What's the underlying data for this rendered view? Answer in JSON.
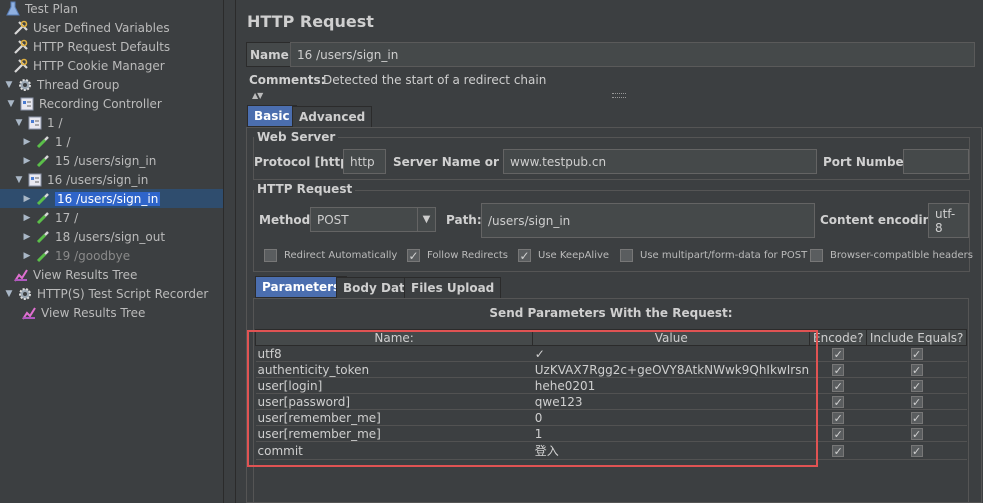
{
  "tree": {
    "items": [
      {
        "label": "Test Plan",
        "icon": "flask-icon",
        "toggle": ""
      },
      {
        "label": "User Defined Variables",
        "icon": "wrench-icon",
        "toggle": ""
      },
      {
        "label": "HTTP Request Defaults",
        "icon": "wrench-icon",
        "toggle": ""
      },
      {
        "label": "HTTP Cookie Manager",
        "icon": "wrench-icon",
        "toggle": ""
      },
      {
        "label": "Thread Group",
        "icon": "gear-icon",
        "toggle": "▼"
      },
      {
        "label": "Recording Controller",
        "icon": "controller-icon",
        "toggle": "▼"
      },
      {
        "label": "1 /",
        "icon": "controller-icon",
        "toggle": "▼"
      },
      {
        "label": "1 /",
        "icon": "pipette-icon",
        "toggle": "▶"
      },
      {
        "label": "15 /users/sign_in",
        "icon": "pipette-icon",
        "toggle": "▶"
      },
      {
        "label": "16 /users/sign_in",
        "icon": "controller-icon",
        "toggle": "▼"
      },
      {
        "label": "16 /users/sign_in",
        "icon": "pipette-icon",
        "toggle": "▶",
        "selected": true
      },
      {
        "label": "17 /",
        "icon": "pipette-icon",
        "toggle": "▶"
      },
      {
        "label": "18 /users/sign_out",
        "icon": "pipette-icon",
        "toggle": "▶"
      },
      {
        "label": "19 /goodbye",
        "icon": "pipette-icon",
        "toggle": "▶",
        "disabled": true
      },
      {
        "label": "View Results Tree",
        "icon": "chart-icon",
        "toggle": ""
      },
      {
        "label": "HTTP(S) Test Script Recorder",
        "icon": "gear-icon",
        "toggle": "▼"
      },
      {
        "label": "View Results Tree",
        "icon": "chart-icon",
        "toggle": ""
      }
    ]
  },
  "header": {
    "title": "HTTP Request",
    "name_label": "Name:",
    "name_value": "16 /users/sign_in",
    "comments_label": "Comments:",
    "comments_value": "Detected the start of a redirect chain"
  },
  "tabs": {
    "basic": "Basic",
    "advanced": "Advanced"
  },
  "web_server": {
    "legend": "Web Server",
    "protocol_label": "Protocol [http]:",
    "protocol_value": "http",
    "server_label": "Server Name or IP:",
    "server_value": "www.testpub.cn",
    "port_label": "Port Number:",
    "port_value": ""
  },
  "http_request": {
    "legend": "HTTP Request",
    "method_label": "Method:",
    "method_value": "POST",
    "path_label": "Path:",
    "path_value": "/users/sign_in",
    "encoding_label": "Content encoding:",
    "encoding_value": "utf-8"
  },
  "options": [
    {
      "label": "Redirect Automatically",
      "checked": false
    },
    {
      "label": "Follow Redirects",
      "checked": true
    },
    {
      "label": "Use KeepAlive",
      "checked": true
    },
    {
      "label": "Use multipart/form-data for POST",
      "checked": false
    },
    {
      "label": "Browser-compatible headers",
      "checked": false
    }
  ],
  "sub_tabs": {
    "parameters": "Parameters",
    "body": "Body Data",
    "files": "Files Upload"
  },
  "params": {
    "heading": "Send Parameters With the Request:",
    "columns": [
      "Name:",
      "Value",
      "Encode?",
      "Include Equals?"
    ],
    "rows": [
      {
        "name": "utf8",
        "value": "✓"
      },
      {
        "name": "authenticity_token",
        "value": "UzKVAX7Rgg2c+geOVY8AtkNWwk9QhIkwIrsn1a..."
      },
      {
        "name": "user[login]",
        "value": "hehe0201"
      },
      {
        "name": "user[password]",
        "value": "qwe123"
      },
      {
        "name": "user[remember_me]",
        "value": "0"
      },
      {
        "name": "user[remember_me]",
        "value": "1"
      },
      {
        "name": "commit",
        "value": "登入"
      }
    ]
  }
}
